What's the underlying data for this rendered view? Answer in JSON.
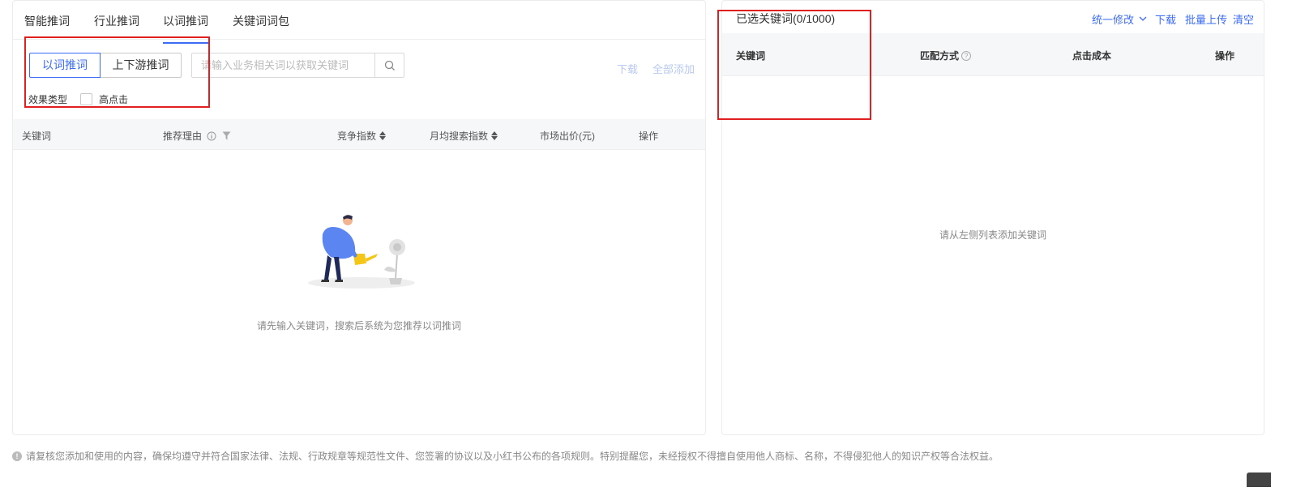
{
  "left": {
    "tabs": [
      "智能推词",
      "行业推词",
      "以词推词",
      "关键词词包"
    ],
    "mode_buttons": [
      "以词推词",
      "上下游推词"
    ],
    "search": {
      "placeholder": "请输入业务相关词以获取关键词",
      "value": ""
    },
    "download_label": "下载",
    "add_all_label": "全部添加",
    "effect_label": "效果类型",
    "high_click_label": "高点击",
    "columns": {
      "keyword": "关键词",
      "reason": "推荐理由",
      "competition": "竞争指数",
      "monthly_search": "月均搜索指数",
      "market_bid": "市场出价(元)",
      "action": "操作"
    },
    "empty_text": "请先输入关键词，搜索后系统为您推荐以词推词"
  },
  "right": {
    "title": "已选关键词(0/1000)",
    "batch_edit_label": "统一修改",
    "download_label": "下载",
    "batch_upload_label": "批量上传",
    "clear_label": "清空",
    "columns": {
      "keyword": "关键词",
      "match": "匹配方式",
      "click_cost": "点击成本",
      "action": "操作"
    },
    "empty_text": "请从左侧列表添加关键词"
  },
  "footer": "请复核您添加和使用的内容，确保均遵守并符合国家法律、法规、行政规章等规范性文件、您签署的协议以及小红书公布的各项规则。特别提醒您，未经授权不得擅自使用他人商标、名称，不得侵犯他人的知识产权等合法权益。",
  "colors": {
    "accent": "#3b6cf6",
    "annotation_red": "#e02020"
  }
}
